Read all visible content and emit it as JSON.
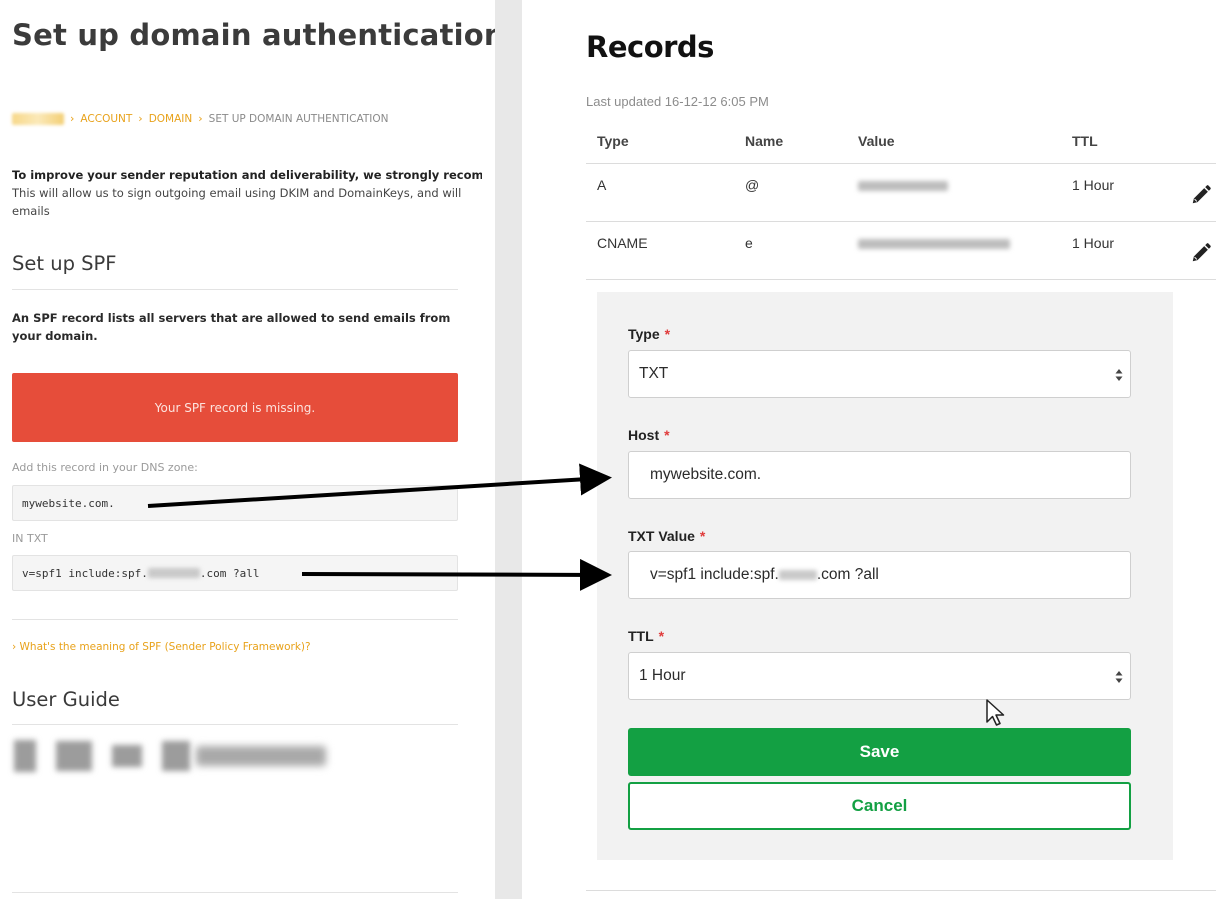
{
  "left": {
    "title": "Set up domain authentication",
    "breadcrumb": {
      "items": [
        "ACCOUNT",
        "DOMAIN"
      ],
      "current": "SET UP DOMAIN AUTHENTICATION",
      "separator": "›"
    },
    "intro": {
      "line1": "To improve your sender reputation and deliverability, we strongly recomm",
      "line2": "This will allow us to sign outgoing email using DKIM and DomainKeys, and will",
      "line3": "emails"
    },
    "spf_heading": "Set up SPF",
    "spf_description": "An SPF record lists all servers that are allowed to send emails from your domain.",
    "alert": "Your SPF record is missing.",
    "dns_label": "Add this record in your DNS zone:",
    "dns_host": "mywebsite.com.",
    "in_txt_label": "IN TXT",
    "txt_prefix": "v=spf1 include:spf.",
    "txt_suffix": ".com ?all",
    "spf_link": "› What's the meaning of SPF (Sender Policy Framework)?",
    "user_guide_heading": "User Guide"
  },
  "right": {
    "title": "Records",
    "last_updated": "Last updated 16-12-12 6:05 PM",
    "table": {
      "headers": [
        "Type",
        "Name",
        "Value",
        "TTL"
      ],
      "rows": [
        {
          "type": "A",
          "name": "@",
          "ttl": "1 Hour"
        },
        {
          "type": "CNAME",
          "name": "e",
          "ttl": "1 Hour"
        }
      ]
    },
    "form": {
      "type_label": "Type",
      "type_value": "TXT",
      "host_label": "Host",
      "host_value": "mywebsite.com.",
      "txt_label": "TXT Value",
      "txt_prefix": "v=spf1 include:spf.",
      "txt_suffix": ".com ?all",
      "ttl_label": "TTL",
      "ttl_value": "1 Hour",
      "required_mark": "*",
      "save_label": "Save",
      "cancel_label": "Cancel"
    }
  },
  "colors": {
    "accent_orange": "#e8a21b",
    "alert_red": "#e64d3a",
    "save_green": "#13a043",
    "required_red": "#e03b3b"
  },
  "icons": [
    "pencil-icon",
    "select-arrows-icon",
    "mouse-cursor-icon",
    "arrow-right-icon"
  ]
}
